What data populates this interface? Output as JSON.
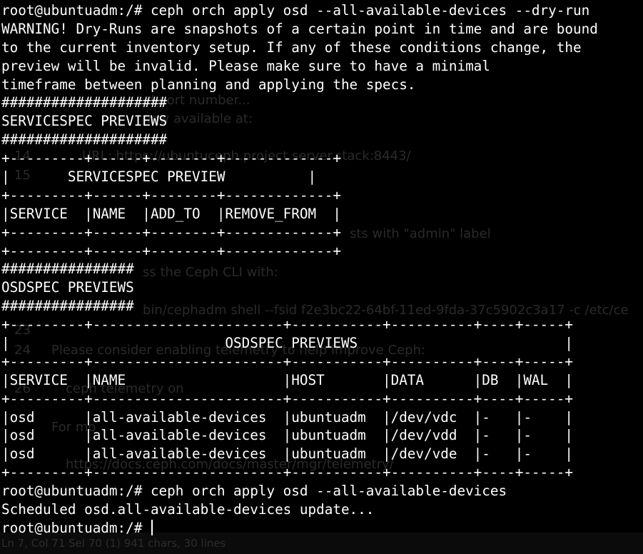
{
  "terminal": {
    "lines": [
      "root@ubuntuadm:/# ceph orch apply osd --all-available-devices --dry-run",
      "WARNING! Dry-Runs are snapshots of a certain point in time and are bound",
      "to the current inventory setup. If any of these conditions change, the",
      "preview will be invalid. Please make sure to have a minimal",
      "timeframe between planning and applying the specs.",
      "####################",
      "SERVICESPEC PREVIEWS",
      "####################",
      "+---------+------+--------+-------------+",
      "|       SERVICESPEC PREVIEW          |",
      "+---------+------+--------+-------------+",
      "|SERVICE  |NAME  |ADD_TO  |REMOVE_FROM  |",
      "+---------+------+--------+-------------+",
      "+---------+------+--------+-------------+",
      "################",
      "OSDSPEC PREVIEWS",
      "################",
      "+---------+-----------------------+-----------+----------+----+-----+",
      "|                          OSDSPEC PREVIEWS                         |",
      "+---------+-----------------------+-----------+----------+----+-----+",
      "|SERVICE  |NAME                   |HOST       |DATA      |DB  |WAL  |",
      "+---------+-----------------------+-----------+----------+----+-----+",
      "|osd      |all-available-devices  |ubuntuadm  |/dev/vdc  |-   |-    |",
      "|osd      |all-available-devices  |ubuntuadm  |/dev/vdd  |-   |-    |",
      "|osd      |all-available-devices  |ubuntuadm  |/dev/vde  |-   |-    |",
      "+---------+-----------------------+-----------+----------+----+-----+",
      "root@ubuntuadm:/# ceph orch apply osd --all-available-devices",
      "Scheduled osd.all-available-devices update...",
      "root@ubuntuadm:/# "
    ]
  },
  "background_window": {
    "fragments": [
      "d port number...",
      "now available at:",
      "URL: https://ubuntuceph.project.server.stack:8443/",
      "sts with \"admin\" label",
      "ss the Ceph CLI with:",
      "bin/cephadm shell --fsid f2e3bc22-64bf-11ed-9fda-37c5902c3a17 -c /etc/ce",
      "Please consider enabling telemetry to help improve Ceph:",
      "ceph telemetry on",
      "For mo",
      "https://docs.ceph.com/docs/master/mgr/telemetry/"
    ],
    "line_numbers": [
      "14",
      "15",
      "23",
      "24",
      "26"
    ],
    "status": "Ln 7, Col 71   Sel 70 (1)   941 chars, 30 lines"
  },
  "colors": {
    "background": "#000000",
    "foreground": "#ffffff",
    "ghost_text": "#2a2a2a"
  }
}
